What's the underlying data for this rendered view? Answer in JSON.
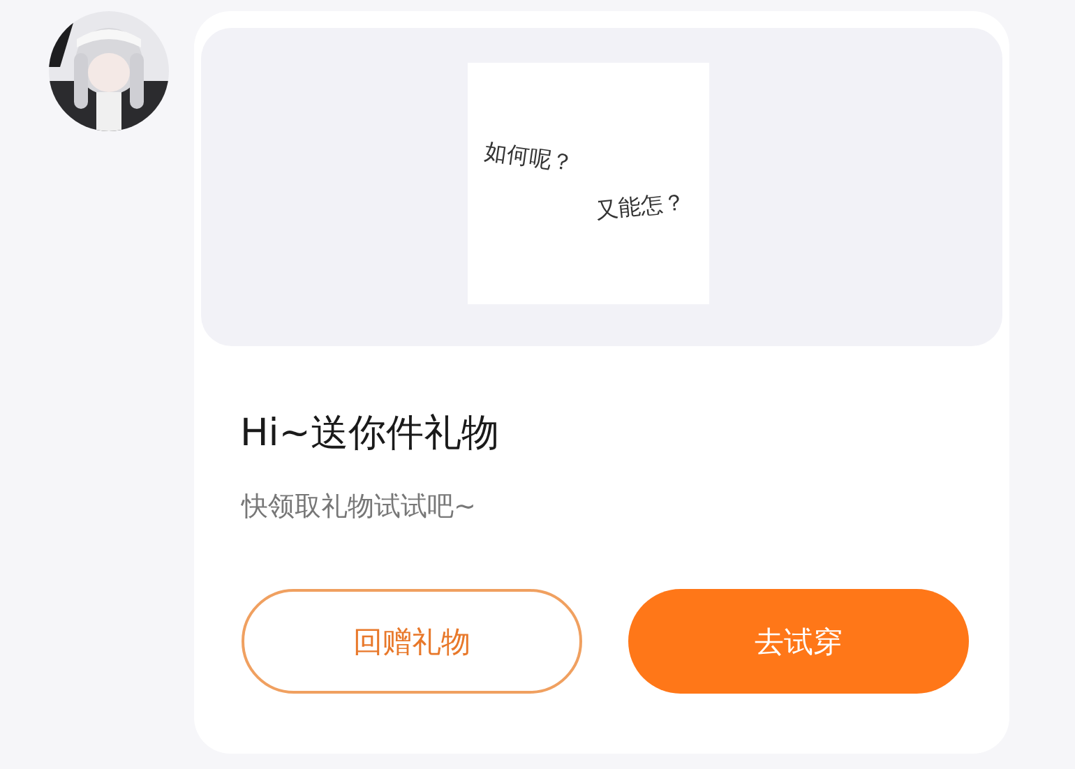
{
  "message": {
    "sticker": {
      "lines": [
        "如何呢？",
        "又能怎？"
      ]
    },
    "title": "Hi~送你件礼物",
    "subtitle": "快领取礼物试试吧~",
    "buttons": [
      {
        "label": "回赠礼物",
        "kind": "outline"
      },
      {
        "label": "去试穿",
        "kind": "primary"
      }
    ]
  }
}
